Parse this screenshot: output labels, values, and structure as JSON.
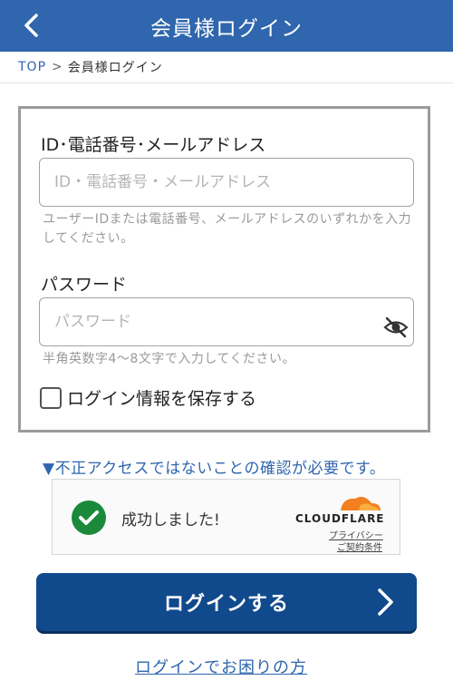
{
  "header": {
    "title": "会員様ログイン",
    "back_icon": "chevron-left-icon"
  },
  "breadcrumb": {
    "home": "TOP",
    "separator": ">",
    "current": "会員様ログイン"
  },
  "form": {
    "id_label": "ID･電話番号･メールアドレス",
    "id_placeholder": "ID・電話番号・メールアドレス",
    "id_value": "",
    "id_hint": "ユーザーIDまたは電話番号、メールアドレスのいずれかを入力してください。",
    "password_label": "パスワード",
    "password_placeholder": "パスワード",
    "password_value": "",
    "password_hint": "半角英数字4〜8文字で入力してください。",
    "visibility_icon": "eye-off-icon",
    "remember_label": "ログイン情報を保存する",
    "remember_checked": false
  },
  "verification": {
    "notice": "▼不正アクセスではないことの確認が必要です。",
    "status": "成功しました!",
    "brand": "CLOUDFLARE",
    "privacy_link": "プライバシー",
    "terms_link": "ご契約条件",
    "success_color": "#1a8a3a",
    "brand_color": "#f38020"
  },
  "actions": {
    "login_label": "ログインする",
    "help_link": "ログインでお困りの方"
  },
  "colors": {
    "header": "#2f66ad",
    "primary_button": "#114a8c",
    "link": "#2f66ad"
  }
}
